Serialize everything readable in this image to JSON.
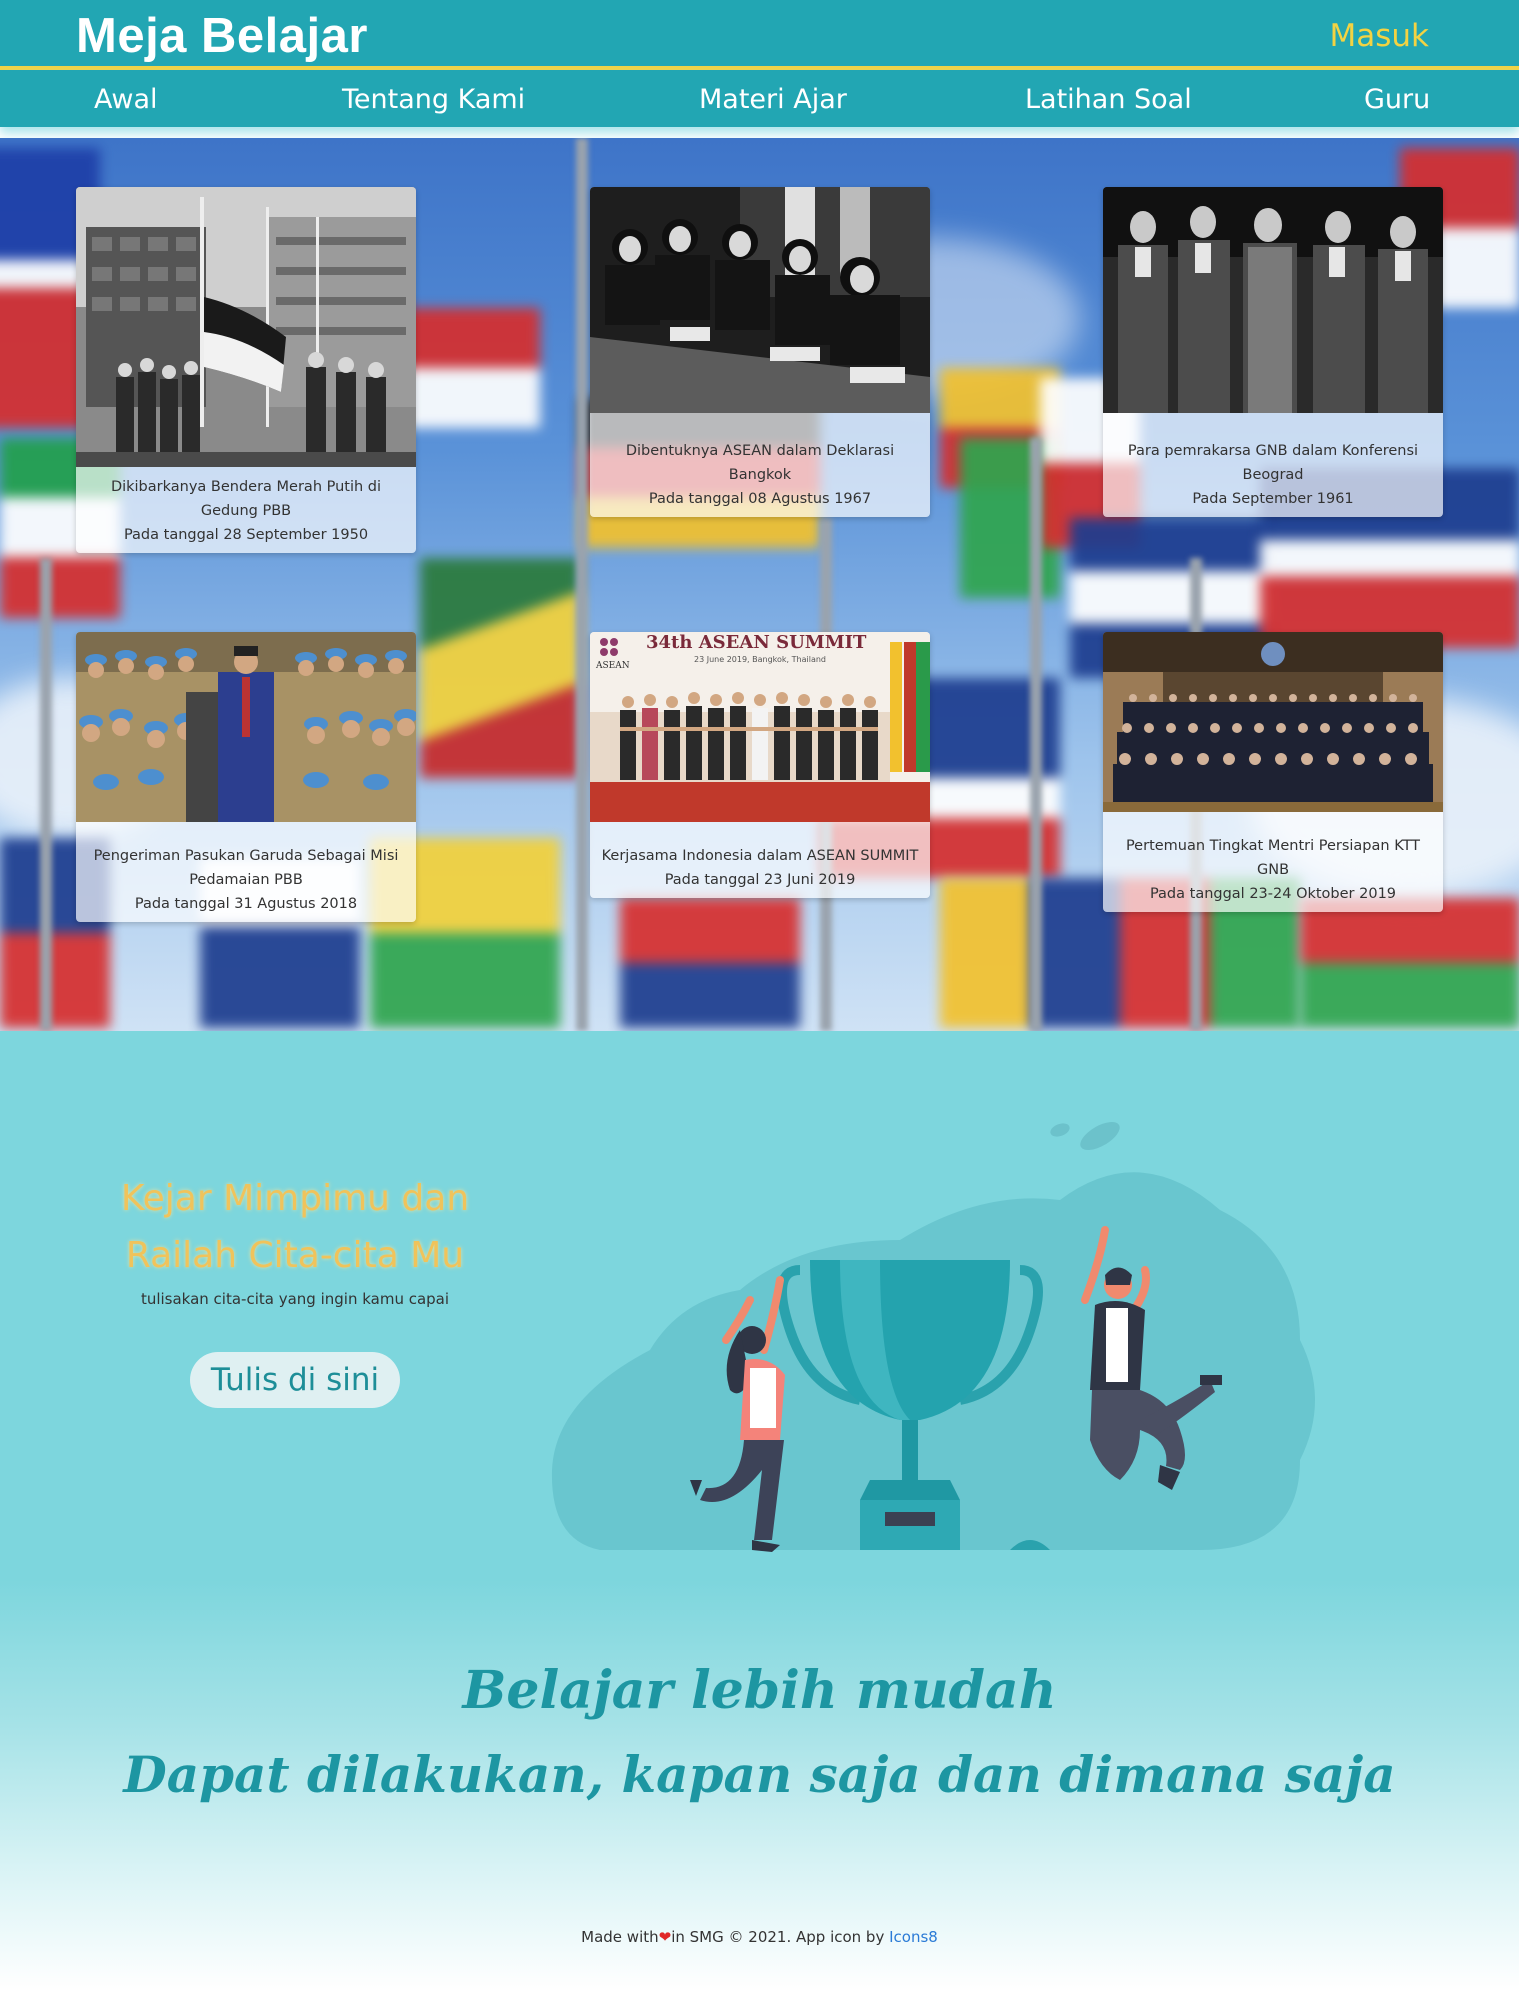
{
  "header": {
    "brand": "Meja Belajar",
    "login": "Masuk"
  },
  "nav": [
    "Awal",
    "Tentang Kami",
    "Materi Ajar",
    "Latihan Soal",
    "Guru"
  ],
  "cards": [
    {
      "title": "Dikibarkanya Bendera Merah Putih di Gedung PBB",
      "date": "Pada tanggal 28 September 1950"
    },
    {
      "title": "Dibentuknya ASEAN dalam Deklarasi Bangkok",
      "date": "Pada tanggal 08 Agustus 1967"
    },
    {
      "title": "Para pemrakarsa GNB dalam Konferensi Beograd",
      "date": "Pada September 1961"
    },
    {
      "title": "Pengeriman Pasukan Garuda Sebagai Misi Pedamaian PBB",
      "date": "Pada tanggal 31 Agustus 2018"
    },
    {
      "title": "Kerjasama Indonesia dalam ASEAN SUMMIT",
      "date": "Pada tanggal 23 Juni 2019"
    },
    {
      "title": "Pertemuan Tingkat Mentri Persiapan KTT GNB",
      "date": "Pada tanggal 23-24 Oktober 2019"
    }
  ],
  "summit_banner": {
    "title": "34th ASEAN SUMMIT",
    "subtitle": "23 June 2019, Bangkok, Thailand",
    "logo_text": "ASEAN"
  },
  "dream": {
    "title_line1": "Kejar Mimpimu dan",
    "title_line2": "Railah Cita-cita Mu",
    "subtitle": "tulisakan cita-cita yang ingin kamu capai",
    "button": "Tulis di sini"
  },
  "slogan": {
    "line1": "Belajar lebih mudah",
    "line2": "Dapat dilakukan, kapan saja dan dimana saja"
  },
  "footer": {
    "prefix": "Made with",
    "suffix": "in SMG © 2021. App icon by",
    "link": "Icons8",
    "heart_icon": "heart-icon"
  },
  "colors": {
    "primary": "#22a6b3",
    "accent": "#f3d342",
    "teal_bg": "#7dd6dd",
    "slogan": "#1d96a2",
    "dream_title": "#f0c35b"
  }
}
